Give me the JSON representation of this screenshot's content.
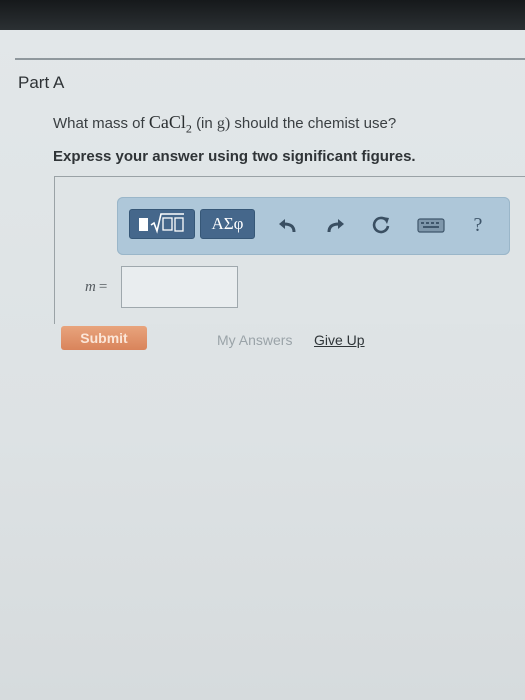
{
  "part": {
    "title": "Part A"
  },
  "question": {
    "prefix": "What mass of",
    "compound_base": "CaCl",
    "compound_subscript": "2",
    "unit_open": "(in",
    "unit": "g",
    "unit_close": ")",
    "suffix": "should the chemist use?"
  },
  "instruction": "Express your answer using two significant figures.",
  "toolbar": {
    "templates_button": {
      "icon": "templates-icon"
    },
    "greek_button_label": "ΑΣφ",
    "undo": {
      "icon": "undo-icon"
    },
    "redo": {
      "icon": "redo-icon"
    },
    "reset": {
      "icon": "reset-icon"
    },
    "keyboard": {
      "icon": "keyboard-icon"
    },
    "help_label": "?"
  },
  "answer": {
    "variable": "m",
    "equals": "=",
    "value": ""
  },
  "actions": {
    "submit_label": "Submit",
    "my_answers_label": "My Answers",
    "give_up_label": "Give Up"
  },
  "colors": {
    "toolbar_bg": "#aec7d9",
    "toolbar_button": "#45678b",
    "submit_button": "#d9845b"
  }
}
